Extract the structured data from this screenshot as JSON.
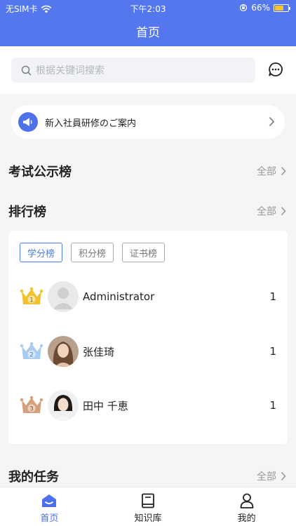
{
  "status_bar": {
    "carrier": "无SIM卡",
    "time": "下午2:03",
    "battery": "66%",
    "battery_level": 0.66
  },
  "header": {
    "title": "首页"
  },
  "search": {
    "placeholder": "根据关键词搜索"
  },
  "notice": {
    "text": "新入社員研修のご案内"
  },
  "sections": {
    "exam": {
      "title": "考试公示榜",
      "more": "全部"
    },
    "ranking": {
      "title": "排行榜",
      "more": "全部"
    },
    "tasks": {
      "title": "我的任务",
      "more": "全部"
    }
  },
  "ranking": {
    "tabs": [
      "学分榜",
      "积分榜",
      "证书榜"
    ],
    "active_tab": 0,
    "rows": [
      {
        "rank": "1",
        "name": "Administrator",
        "value": "1",
        "crown_color": "#f2c12e"
      },
      {
        "rank": "2",
        "name": "张佳琦",
        "value": "1",
        "crown_color": "#a9cdef"
      },
      {
        "rank": "3",
        "name": "田中 千恵",
        "value": "1",
        "crown_color": "#d6a07a"
      }
    ]
  },
  "tabbar": {
    "items": [
      "首页",
      "知识库",
      "我的"
    ],
    "active": 0,
    "accent": "#4a6ff0"
  },
  "colors": {
    "header_bg": "#5577ee",
    "accent": "#4a7ff0"
  }
}
